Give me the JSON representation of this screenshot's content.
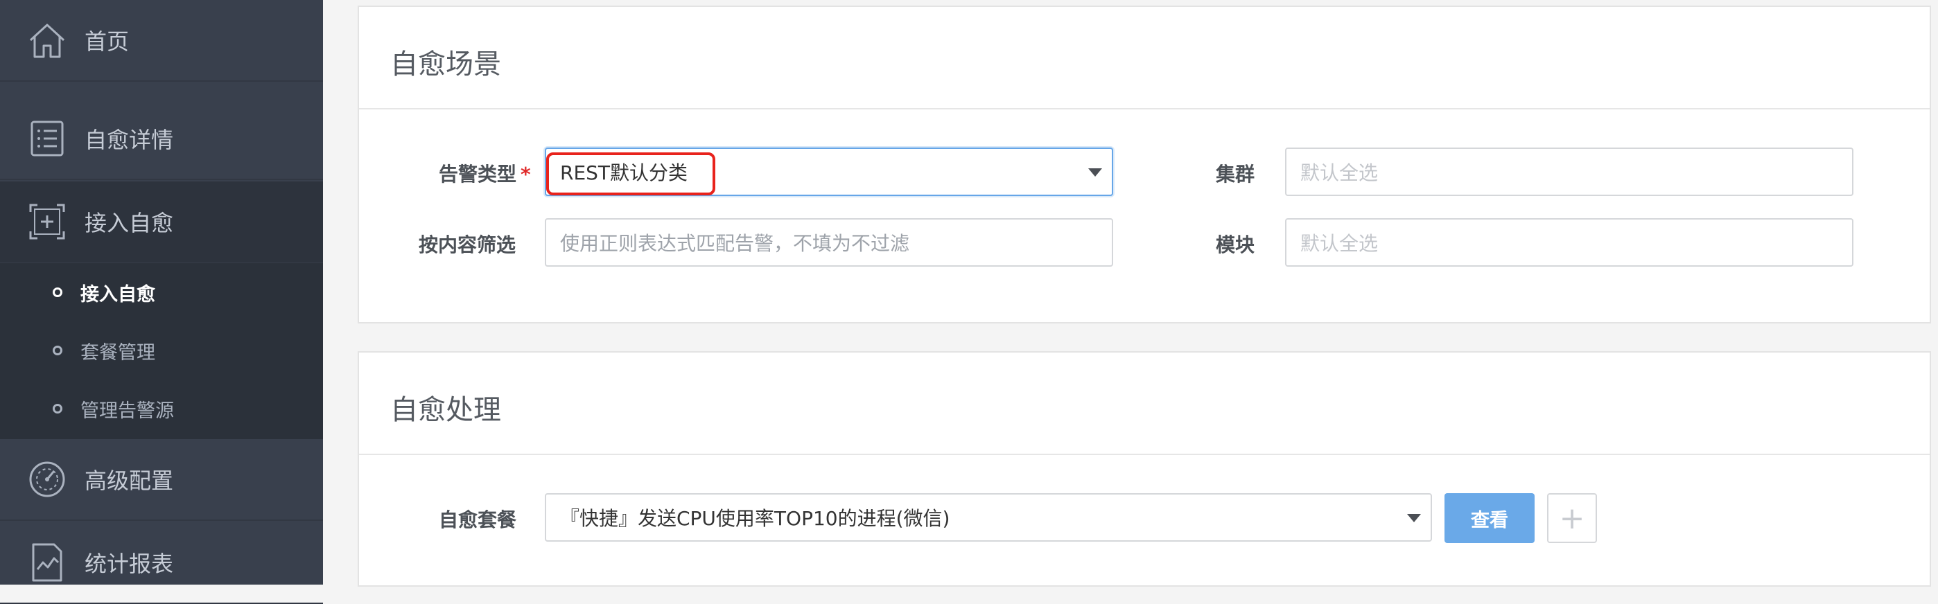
{
  "sidebar": {
    "items": [
      {
        "label": "首页",
        "icon": "home-icon"
      },
      {
        "label": "自愈详情",
        "icon": "list-detail-icon"
      },
      {
        "label": "接入自愈",
        "icon": "access-frame-icon"
      },
      {
        "label": "高级配置",
        "icon": "gauge-icon"
      },
      {
        "label": "统计报表",
        "icon": "report-chart-icon"
      }
    ],
    "subitems": [
      {
        "label": "接入自愈"
      },
      {
        "label": "套餐管理"
      },
      {
        "label": "管理告警源"
      }
    ]
  },
  "scene": {
    "title": "自愈场景",
    "alarm_type_label": "告警类型",
    "required_mark": "*",
    "alarm_type_value": "REST默认分类",
    "filter_label": "按内容筛选",
    "filter_placeholder": "使用正则表达式匹配告警，不填为不过滤",
    "cluster_label": "集群",
    "cluster_placeholder": "默认全选",
    "module_label": "模块",
    "module_placeholder": "默认全选"
  },
  "handle": {
    "title": "自愈处理",
    "package_label": "自愈套餐",
    "package_value": "『快捷』发送CPU使用率TOP10的进程(微信)",
    "view_button": "查看",
    "add_button": "+"
  },
  "colors": {
    "sidebar_bg": "#39404d",
    "accent": "#6aa9e8",
    "highlight_border": "#e8231c",
    "required": "#e02a2a"
  }
}
